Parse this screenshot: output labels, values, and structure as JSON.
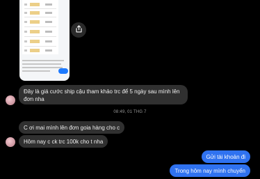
{
  "shared_image": {
    "icon": "share-icon"
  },
  "messages": {
    "m1_line1": "Đây là giá cước ship cậu tham khảo trc để 5 ngày sau mình lên",
    "m1_line2": "đơn nha",
    "timestamp": "08:49, 01 THG 7",
    "m2": "C ơi mai mình lên đơn goia hàng cho c",
    "m3": "Hôm nay c ck trc 100k cho t nha",
    "m4": "Gửi tài khoản đi",
    "m5": "Trong hôm nay mình chuyển"
  },
  "colors": {
    "background": "#000000",
    "incoming_bubble": "#303030",
    "outgoing_bubble": "#2f72f0"
  }
}
